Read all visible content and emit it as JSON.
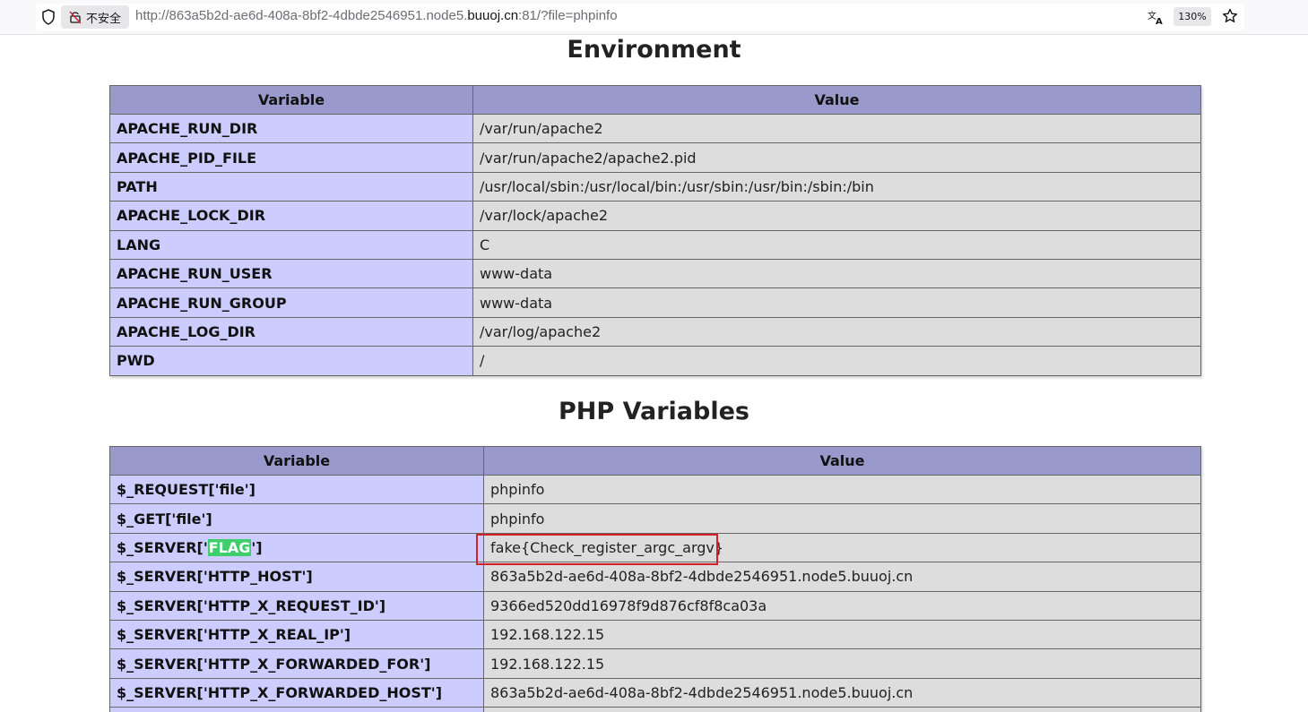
{
  "browser": {
    "insecure_label": "不安全",
    "url_prefix": "http://863a5b2d-ae6d-408a-8bf2-4dbde2546951.node5.",
    "url_domain": "buuoj.cn",
    "url_suffix": ":81/?file=phpinfo",
    "zoom": "130%"
  },
  "environment": {
    "title": "Environment",
    "headers": [
      "Variable",
      "Value"
    ],
    "rows": [
      {
        "name": "APACHE_RUN_DIR",
        "value": "/var/run/apache2"
      },
      {
        "name": "APACHE_PID_FILE",
        "value": "/var/run/apache2/apache2.pid"
      },
      {
        "name": "PATH",
        "value": "/usr/local/sbin:/usr/local/bin:/usr/sbin:/usr/bin:/sbin:/bin"
      },
      {
        "name": "APACHE_LOCK_DIR",
        "value": "/var/lock/apache2"
      },
      {
        "name": "LANG",
        "value": "C"
      },
      {
        "name": "APACHE_RUN_USER",
        "value": "www-data"
      },
      {
        "name": "APACHE_RUN_GROUP",
        "value": "www-data"
      },
      {
        "name": "APACHE_LOG_DIR",
        "value": "/var/log/apache2"
      },
      {
        "name": "PWD",
        "value": "/"
      }
    ]
  },
  "php_variables": {
    "title": "PHP Variables",
    "headers": [
      "Variable",
      "Value"
    ],
    "rows": [
      {
        "name": "$_REQUEST['file']",
        "value": "phpinfo"
      },
      {
        "name": "$_GET['file']",
        "value": "phpinfo"
      },
      {
        "name_prefix": "$_SERVER['",
        "name_highlight": "FLAG",
        "name_suffix": "']",
        "value": "fake{Check_register_argc_argv}"
      },
      {
        "name": "$_SERVER['HTTP_HOST']",
        "value": "863a5b2d-ae6d-408a-8bf2-4dbde2546951.node5.buuoj.cn"
      },
      {
        "name": "$_SERVER['HTTP_X_REQUEST_ID']",
        "value": "9366ed520dd16978f9d876cf8f8ca03a"
      },
      {
        "name": "$_SERVER['HTTP_X_REAL_IP']",
        "value": "192.168.122.15"
      },
      {
        "name": "$_SERVER['HTTP_X_FORWARDED_FOR']",
        "value": "192.168.122.15"
      },
      {
        "name": "$_SERVER['HTTP_X_FORWARDED_HOST']",
        "value": "863a5b2d-ae6d-408a-8bf2-4dbde2546951.node5.buuoj.cn"
      }
    ]
  },
  "colors": {
    "header_bg": "#9999cc",
    "name_bg": "#ccccff",
    "value_bg": "#dddddd",
    "highlight": "#3ecf6c",
    "annotation_box": "#d3202a"
  }
}
